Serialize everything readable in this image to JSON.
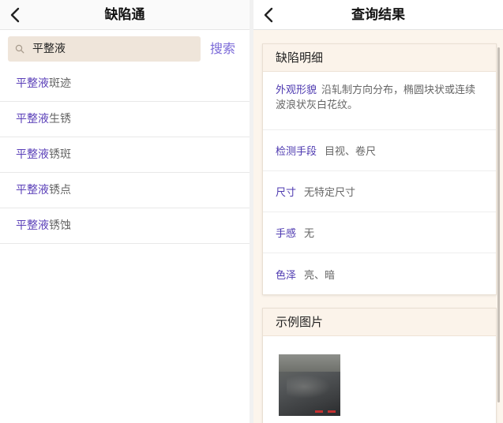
{
  "left_screen": {
    "title": "缺陷通",
    "search": {
      "value": "平整液",
      "button_label": "搜索"
    },
    "results": [
      {
        "keyword": "平整液",
        "suffix": "斑迹"
      },
      {
        "keyword": "平整液",
        "suffix": "生锈"
      },
      {
        "keyword": "平整液",
        "suffix": "锈斑"
      },
      {
        "keyword": "平整液",
        "suffix": "锈点"
      },
      {
        "keyword": "平整液",
        "suffix": "锈蚀"
      }
    ]
  },
  "right_screen": {
    "title": "查询结果",
    "detail_card": {
      "heading": "缺陷明细",
      "rows": [
        {
          "label": "外观形貌",
          "value": "沿轧制方向分布，椭圆块状或连续波浪状灰白花纹。"
        },
        {
          "label": "检测手段",
          "value": "目视、卷尺"
        },
        {
          "label": "尺寸",
          "value": "无特定尺寸"
        },
        {
          "label": "手感",
          "value": "无"
        },
        {
          "label": "色泽",
          "value": "亮、暗"
        }
      ]
    },
    "image_card": {
      "heading": "示例图片"
    }
  },
  "colors": {
    "accent_purple": "#5a3fb8",
    "search_button": "#7b6ad8",
    "search_field_bg": "#efe5da",
    "panel_bg": "#fcf5ec"
  },
  "icons": {
    "back": "chevron-left-icon",
    "search": "magnifier-icon"
  }
}
